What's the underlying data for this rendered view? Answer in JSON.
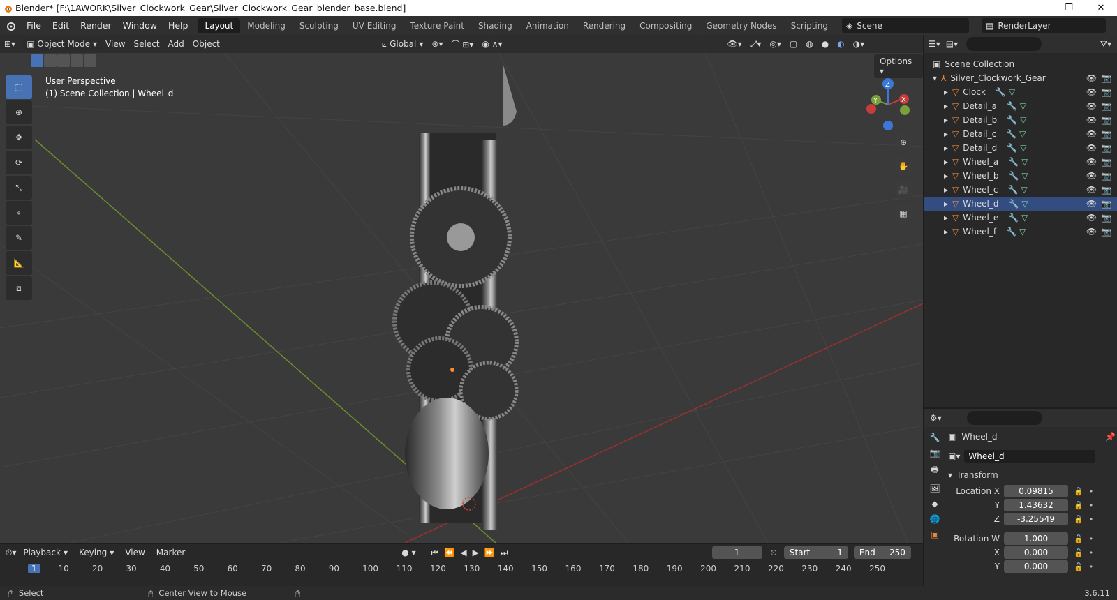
{
  "window": {
    "title": "Blender* [F:\\1AWORK\\Silver_Clockwork_Gear\\Silver_Clockwork_Gear_blender_base.blend]",
    "minimize": "—",
    "maximize": "❐",
    "close": "✕"
  },
  "menu": {
    "items": [
      "File",
      "Edit",
      "Render",
      "Window",
      "Help"
    ],
    "workspace_tabs": [
      "Layout",
      "Modeling",
      "Sculpting",
      "UV Editing",
      "Texture Paint",
      "Shading",
      "Animation",
      "Rendering",
      "Compositing",
      "Geometry Nodes",
      "Scripting"
    ],
    "active_tab": "Layout",
    "add_tab": "+",
    "scene": "Scene",
    "render_layer": "RenderLayer"
  },
  "viewport": {
    "mode": "Object Mode",
    "menus": [
      "View",
      "Select",
      "Add",
      "Object"
    ],
    "orientation": "Global",
    "info_line1": "User Perspective",
    "info_line2": "(1) Scene Collection | Wheel_d",
    "options": "Options",
    "gizmo_axes": [
      "X",
      "Y",
      "Z"
    ]
  },
  "outliner": {
    "root": "Scene Collection",
    "collection": "Silver_Clockwork_Gear",
    "objects": [
      "Clock",
      "Detail_a",
      "Detail_b",
      "Detail_c",
      "Detail_d",
      "Wheel_a",
      "Wheel_b",
      "Wheel_c",
      "Wheel_d",
      "Wheel_e",
      "Wheel_f"
    ],
    "selected": "Wheel_d"
  },
  "properties": {
    "object_name": "Wheel_d",
    "data_name": "Wheel_d",
    "panel": "Transform",
    "rows": [
      {
        "label": "Location X",
        "value": "0.09815"
      },
      {
        "label": "Y",
        "value": "1.43632"
      },
      {
        "label": "Z",
        "value": "-3.25549"
      },
      {
        "label": "Rotation W",
        "value": "1.000"
      },
      {
        "label": "X",
        "value": "0.000"
      },
      {
        "label": "Y",
        "value": "0.000"
      }
    ]
  },
  "timeline": {
    "menus": [
      "Playback",
      "Keying",
      "View",
      "Marker"
    ],
    "current_frame": "1",
    "start_label": "Start",
    "start": "1",
    "end_label": "End",
    "end": "250",
    "ruler": [
      "1",
      "10",
      "20",
      "30",
      "40",
      "50",
      "60",
      "70",
      "80",
      "90",
      "100",
      "110",
      "120",
      "130",
      "140",
      "150",
      "160",
      "170",
      "180",
      "190",
      "200",
      "210",
      "220",
      "230",
      "240",
      "250"
    ]
  },
  "status": {
    "left": "Select",
    "middle": "Center View to Mouse",
    "version": "3.6.11"
  },
  "colors": {
    "accent": "#4772b3",
    "object_orange": "#e8873a",
    "x_axis": "#c83c3c",
    "y_axis": "#7aa03c",
    "z_axis": "#3c78d8"
  }
}
